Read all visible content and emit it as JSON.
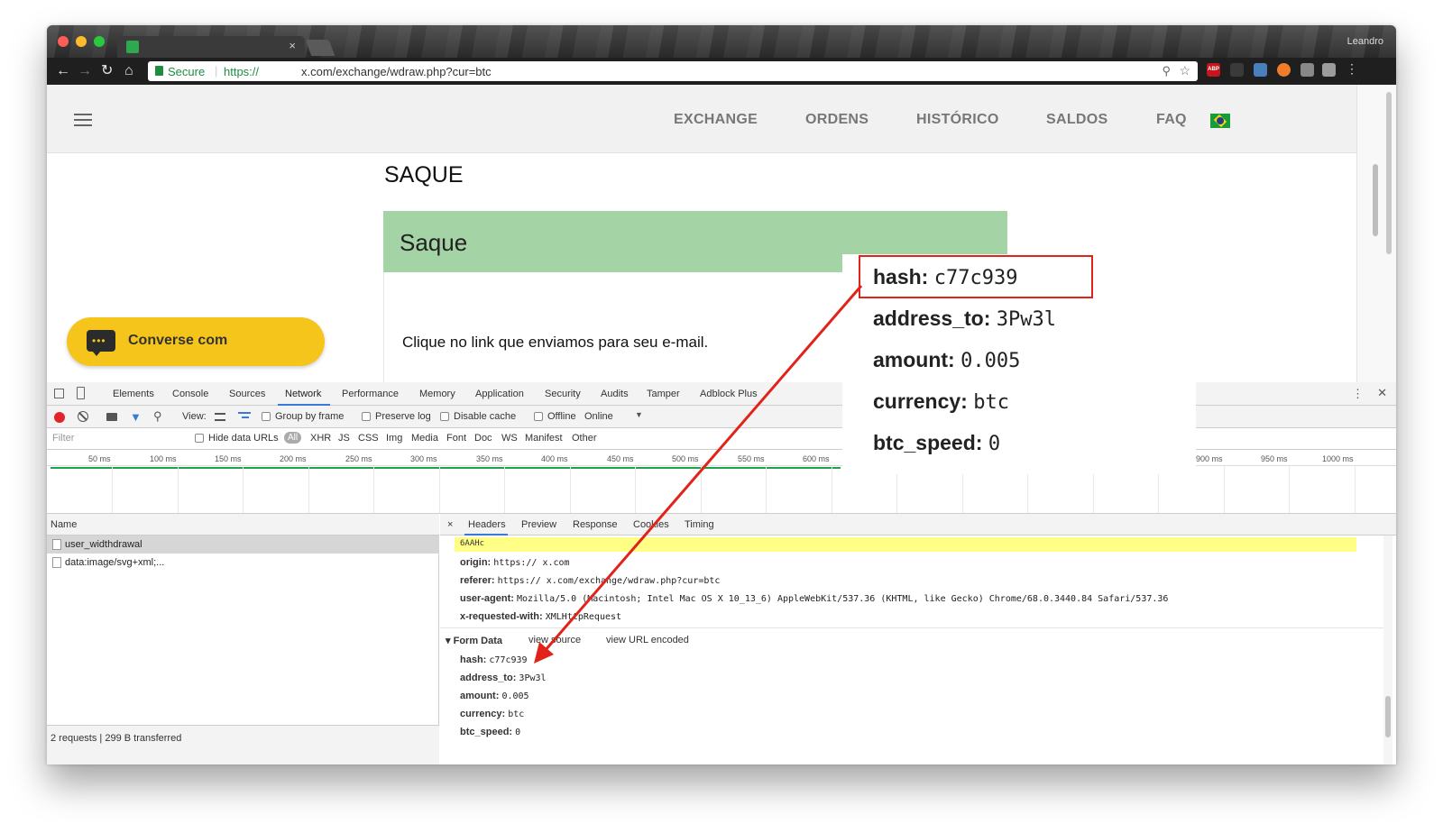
{
  "browser": {
    "user_name": "Leandro",
    "tab_close": "×",
    "secure_label": "Secure",
    "url_scheme": "https://",
    "url_rest": "x.com/exchange/wdraw.php?cur=btc"
  },
  "site": {
    "nav": [
      "EXCHANGE",
      "ORDENS",
      "HISTÓRICO",
      "SALDOS",
      "FAQ"
    ],
    "page_title": "SAQUE",
    "panel_title": "Saque",
    "panel_text": "Clique no link que enviamos para seu e-mail.",
    "chat_label": "Converse com"
  },
  "devtools": {
    "tabs": [
      "Elements",
      "Console",
      "Sources",
      "Network",
      "Performance",
      "Memory",
      "Application",
      "Security",
      "Audits",
      "Tamper",
      "Adblock Plus"
    ],
    "controls": {
      "view_label": "View:",
      "group_by_frame": "Group by frame",
      "preserve_log": "Preserve log",
      "disable_cache": "Disable cache",
      "offline": "Offline",
      "online": "Online"
    },
    "filter": {
      "placeholder": "Filter",
      "hide_data_urls": "Hide data URLs",
      "types": [
        "All",
        "XHR",
        "JS",
        "CSS",
        "Img",
        "Media",
        "Font",
        "Doc",
        "WS",
        "Manifest",
        "Other"
      ]
    },
    "ticks": [
      "50 ms",
      "100 ms",
      "150 ms",
      "200 ms",
      "250 ms",
      "300 ms",
      "350 ms",
      "400 ms",
      "450 ms",
      "500 ms",
      "550 ms",
      "600 ms",
      "900 ms",
      "950 ms",
      "1000 ms"
    ],
    "requests": {
      "column_name": "Name",
      "rows": [
        "user_widthdrawal",
        "data:image/svg+xml;..."
      ],
      "status": "2 requests | 299 B transferred"
    },
    "detail": {
      "close": "×",
      "tabs": [
        "Headers",
        "Preview",
        "Response",
        "Cookies",
        "Timing"
      ],
      "highlight_fragment": "6AAHc",
      "headers": [
        {
          "key": "origin:",
          "value": "https://        x.com"
        },
        {
          "key": "referer:",
          "value": "https://        x.com/exchange/wdraw.php?cur=btc"
        },
        {
          "key": "user-agent:",
          "value": "Mozilla/5.0 (Macintosh; Intel Mac OS X 10_13_6) AppleWebKit/537.36 (KHTML, like Gecko) Chrome/68.0.3440.84 Safari/537.36"
        },
        {
          "key": "x-requested-with:",
          "value": "XMLHttpRequest"
        }
      ],
      "form_data_label": "Form Data",
      "view_source": "view source",
      "view_url_encoded": "view URL encoded",
      "form_data": [
        {
          "key": "hash:",
          "value": "c77c939"
        },
        {
          "key": "address_to:",
          "value": "3Pw3l"
        },
        {
          "key": "amount:",
          "value": "0.005"
        },
        {
          "key": "currency:",
          "value": "btc"
        },
        {
          "key": "btc_speed:",
          "value": "0"
        }
      ]
    }
  },
  "zoom": {
    "lines": [
      {
        "key": "hash:",
        "value": "c77c939"
      },
      {
        "key": "address_to:",
        "value": "3Pw3l"
      },
      {
        "key": "amount:",
        "value": "0.005"
      },
      {
        "key": "currency:",
        "value": "btc"
      },
      {
        "key": "btc_speed:",
        "value": "0"
      }
    ],
    "highlight_color": "#e2231a"
  }
}
